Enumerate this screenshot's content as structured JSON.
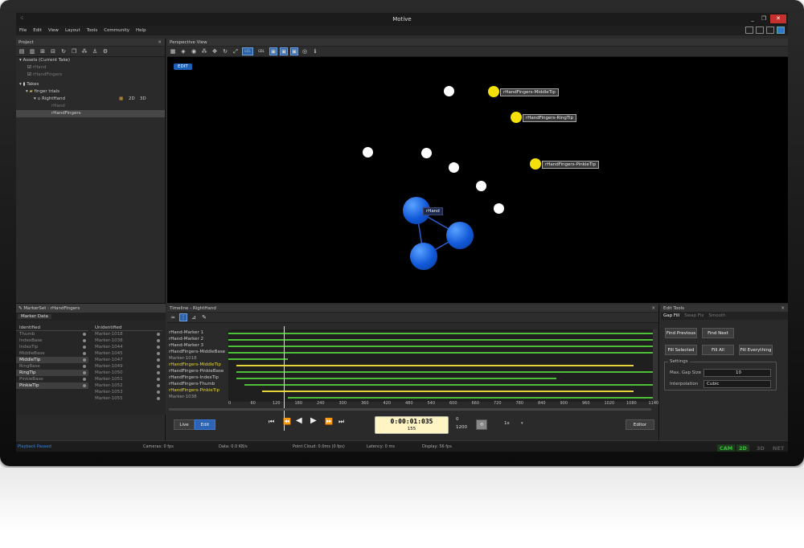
{
  "window": {
    "title": "Motive"
  },
  "menu": [
    "File",
    "Edit",
    "View",
    "Layout",
    "Tools",
    "Community",
    "Help"
  ],
  "project": {
    "title": "Project",
    "assets_header": "Assets (Current Take)",
    "assets": [
      "rHand",
      "rHandFingers"
    ],
    "takes_header": "Takes",
    "folder": "finger trials",
    "take": "RightHand",
    "view_2d": "2D",
    "view_3d": "3D",
    "take_children": [
      "rHand",
      "rHandFingers"
    ]
  },
  "markerset": {
    "title": "MarkerSet : rHandFingers",
    "tab": "Marker Data",
    "identified_header": "Identified",
    "unidentified_header": "Unidentified",
    "identified": [
      {
        "name": "Thumb",
        "hl": false
      },
      {
        "name": "IndexBase",
        "hl": false
      },
      {
        "name": "IndexTip",
        "hl": false
      },
      {
        "name": "MiddleBase",
        "hl": false
      },
      {
        "name": "MiddleTip",
        "hl": true
      },
      {
        "name": "RingBase",
        "hl": false
      },
      {
        "name": "RingTip",
        "hl": true
      },
      {
        "name": "PinkieBase",
        "hl": false
      },
      {
        "name": "PinkieTip",
        "hl": true
      }
    ],
    "unidentified": [
      "Marker-1018",
      "Marker-1038",
      "Marker-1044",
      "Marker-1045",
      "Marker-1047",
      "Marker-1049",
      "Marker-1050",
      "Marker-1051",
      "Marker-1052",
      "Marker-1053",
      "Marker-1055"
    ]
  },
  "perspective": {
    "title": "Perspective View",
    "edit_badge": "EDIT",
    "labels": {
      "middle": "rHandFingers-MiddleTip",
      "ring": "rHandFingers-RingTip",
      "pinkie": "rHandFingers-PinkieTip",
      "hand": "rHand"
    },
    "lcl": "LCL",
    "gbl": "GBL"
  },
  "timeline": {
    "title": "Timeline - RightHand",
    "tracks": [
      {
        "name": "rHand-Marker 1",
        "c": "g"
      },
      {
        "name": "rHand-Marker 2",
        "c": "g"
      },
      {
        "name": "rHand-Marker 3",
        "c": "g"
      },
      {
        "name": "rHandFingers-MiddleBase",
        "c": "g"
      },
      {
        "name": "Marker-1018",
        "c": "d"
      },
      {
        "name": "rHandFingers-MiddleTip",
        "c": "y"
      },
      {
        "name": "rHandFingers-PinkieBase",
        "c": "g"
      },
      {
        "name": "rHandFingers-IndexTip",
        "c": "g"
      },
      {
        "name": "rHandFingers-Thumb",
        "c": "g"
      },
      {
        "name": "rHandFingers-PinkieTip",
        "c": "y"
      },
      {
        "name": "Marker-1038",
        "c": "d"
      }
    ],
    "ticks": [
      "0",
      "60",
      "120",
      "180",
      "240",
      "300",
      "360",
      "420",
      "480",
      "540",
      "600",
      "660",
      "720",
      "780",
      "840",
      "900",
      "960",
      "1020",
      "1080",
      "1140"
    ]
  },
  "transport": {
    "live": "Live",
    "edit": "Edit",
    "timecode": "0:00:01:035",
    "frame": "155",
    "range_start": "0",
    "range_end": "1200",
    "speed": "1x",
    "editor": "Editor"
  },
  "edittools": {
    "title": "Edit Tools",
    "tabs": [
      "Gap Fill",
      "Swap Fix",
      "Smooth"
    ],
    "buttons": {
      "find_previous": "Find Previous",
      "find_next": "Find Next",
      "fill_selected": "Fill Selected",
      "fill_all": "Fill All",
      "fill_everything": "Fill Everything"
    },
    "settings_header": "Settings",
    "max_gap_label": "Max. Gap Size",
    "max_gap_value": "10",
    "interp_label": "Interpolation",
    "interp_value": "Cubic"
  },
  "status": {
    "playback": "Playback Paused",
    "cameras": "Cameras: 0 fps",
    "data": "Data: 0.0 KB/s",
    "pointcloud": "Point Cloud: 0.0ms (0 fps)",
    "latency": "Latency: 0 ms",
    "display": "Display: 56 fps",
    "modes": [
      "CAM",
      "2D",
      "3D",
      "NET"
    ]
  },
  "colors": {
    "accent": "#2c64b3",
    "label_yellow": "#f4e00a",
    "marker_blue": "#1158d8",
    "track_green": "#4fbf3a",
    "track_yellow": "#e6d53a"
  }
}
